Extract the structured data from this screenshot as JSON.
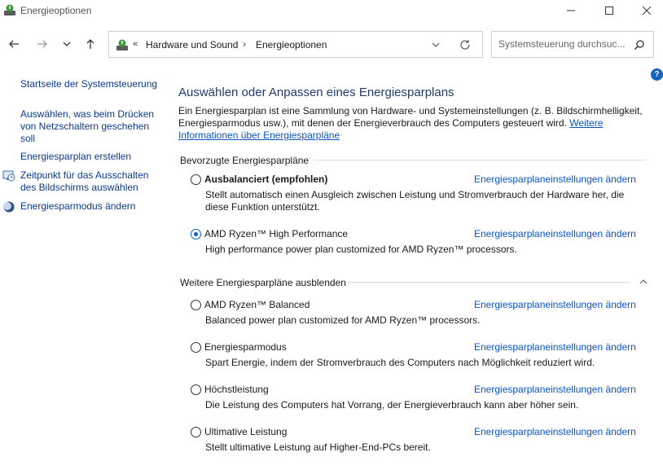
{
  "window": {
    "title": "Energieoptionen"
  },
  "address": {
    "overflow": "«",
    "crumbs": [
      "Hardware und Sound",
      "Energieoptionen"
    ],
    "separator": "›"
  },
  "search": {
    "placeholder": "Systemsteuerung durchsuc..."
  },
  "help_label": "?",
  "sidebar": {
    "items": [
      {
        "label": "Startseite der Systemsteuerung"
      },
      {
        "label": "Auswählen, was beim Drücken von Netzschaltern geschehen soll"
      },
      {
        "label": "Energiesparplan erstellen"
      },
      {
        "label": "Zeitpunkt für das Ausschalten des Bildschirms auswählen"
      },
      {
        "label": "Energiesparmodus ändern"
      }
    ]
  },
  "main": {
    "heading": "Auswählen oder Anpassen eines Energiesparplans",
    "intro_text": "Ein Energiesparplan ist eine Sammlung von Hardware- und Systemeinstellungen (z. B. Bildschirmhelligkeit, Energiesparmodus usw.), mit denen der Energieverbrauch des Computers gesteuert wird. ",
    "intro_link": "Weitere Informationen über Energiesparpläne",
    "preferred_label": "Bevorzugte Energiesparpläne",
    "hidden_label": "Weitere Energiesparpläne ausblenden",
    "change_link": "Energiesparplaneinstellungen ändern",
    "plans": [
      {
        "name": "Ausbalanciert (empfohlen)",
        "desc": "Stellt automatisch einen Ausgleich zwischen Leistung und Stromverbrauch der Hardware her, die diese Funktion unterstützt.",
        "selected": false
      },
      {
        "name": "AMD Ryzen™ High Performance",
        "desc": "High performance power plan customized for AMD Ryzen™ processors.",
        "selected": true
      },
      {
        "name": "AMD Ryzen™ Balanced",
        "desc": "Balanced power plan customized for AMD Ryzen™ processors.",
        "selected": false
      },
      {
        "name": "Energiesparmodus",
        "desc": "Spart Energie, indem der Stromverbrauch des Computers nach Möglichkeit reduziert wird.",
        "selected": false
      },
      {
        "name": "Höchstleistung",
        "desc": "Die Leistung des Computers hat Vorrang, der Energieverbrauch kann aber höher sein.",
        "selected": false
      },
      {
        "name": "Ultimative Leistung",
        "desc": "Stellt ultimative Leistung auf Higher-End-PCs bereit.",
        "selected": false
      }
    ]
  },
  "colors": {
    "link": "#0b54c9",
    "heading": "#1e3c6e",
    "nav_link": "#0b3a8f",
    "radio_selected": "#0a5fd0"
  }
}
